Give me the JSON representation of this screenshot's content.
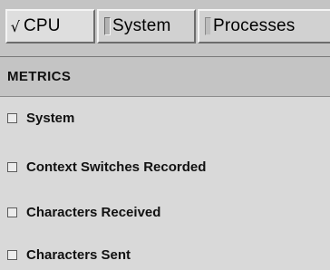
{
  "tabs": [
    {
      "label": "CPU",
      "checked": true
    },
    {
      "label": "System",
      "checked": false
    },
    {
      "label": "Processes",
      "checked": false
    }
  ],
  "check_mark": "√",
  "section": {
    "title": "METRICS"
  },
  "metrics": [
    {
      "label": "System",
      "checked": false
    },
    {
      "label": "Context Switches Recorded",
      "checked": false
    },
    {
      "label": "Characters Received",
      "checked": false
    },
    {
      "label": "Characters Sent",
      "checked": false
    }
  ]
}
